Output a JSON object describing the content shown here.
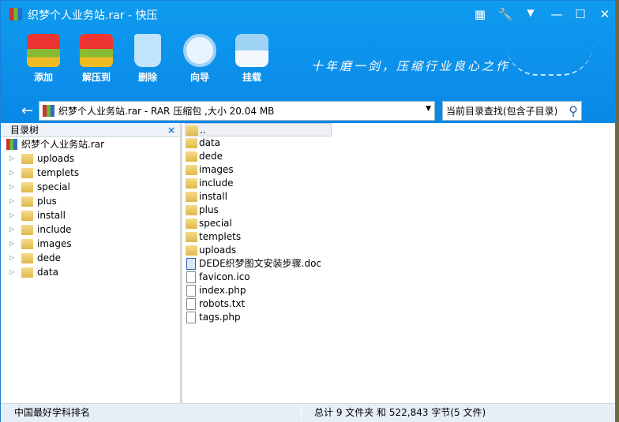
{
  "window": {
    "title": "织梦个人业务站.rar - 快压"
  },
  "toolbar": {
    "items": [
      {
        "label": "添加",
        "icon": "add-archive-icon"
      },
      {
        "label": "解压到",
        "icon": "extract-icon"
      },
      {
        "label": "删除",
        "icon": "recycle-bin-icon"
      },
      {
        "label": "向导",
        "icon": "compass-icon"
      },
      {
        "label": "挂载",
        "icon": "drive-icon"
      }
    ],
    "slogan": "十年磨一剑，压缩行业良心之作"
  },
  "address": {
    "value": "织梦个人业务站.rar - RAR 压缩包 ,大小 20.04 MB"
  },
  "search": {
    "placeholder": "当前目录查找(包含子目录)"
  },
  "tree": {
    "header": "目录树",
    "close": "×",
    "root": "织梦个人业务站.rar",
    "items": [
      "uploads",
      "templets",
      "special",
      "plus",
      "install",
      "include",
      "images",
      "dede",
      "data"
    ]
  },
  "files": {
    "up": "..",
    "folders": [
      "data",
      "dede",
      "images",
      "include",
      "install",
      "plus",
      "special",
      "templets",
      "uploads"
    ],
    "files": [
      {
        "name": "DEDE织梦图文安装步骤.doc",
        "type": "doc"
      },
      {
        "name": "favicon.ico",
        "type": "file"
      },
      {
        "name": "index.php",
        "type": "file"
      },
      {
        "name": "robots.txt",
        "type": "txt"
      },
      {
        "name": "tags.php",
        "type": "file"
      }
    ]
  },
  "status": {
    "left": "中国最好学科排名",
    "right": "总计 9 文件夹  和  522,843 字节(5 文件)"
  },
  "colors": {
    "header": "#0a8ee8",
    "status": "#e6eef8"
  }
}
